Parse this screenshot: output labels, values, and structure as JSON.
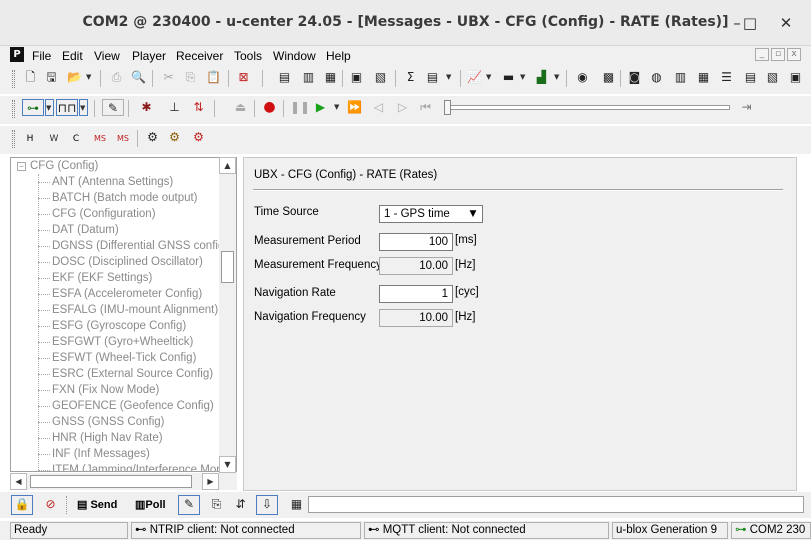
{
  "window": {
    "title": "COM2 @ 230400 - u-center 24.05 - [Messages - UBX - CFG (Config) - RATE (Rates)]"
  },
  "menu": [
    "File",
    "Edit",
    "View",
    "Player",
    "Receiver",
    "Tools",
    "Window",
    "Help"
  ],
  "tree": {
    "root": "CFG (Config)",
    "items": [
      "ANT (Antenna Settings)",
      "BATCH (Batch mode output)",
      "CFG (Configuration)",
      "DAT (Datum)",
      "DGNSS (Differential GNSS configur",
      "DOSC (Disciplined Oscillator)",
      "EKF (EKF Settings)",
      "ESFA (Accelerometer Config)",
      "ESFALG (IMU-mount Alignment)",
      "ESFG (Gyroscope Config)",
      "ESFGWT (Gyro+Wheeltick)",
      "ESFWT (Wheel-Tick Config)",
      "ESRC (External Source Config)",
      "FXN (Fix Now Mode)",
      "GEOFENCE (Geofence Config)",
      "GNSS (GNSS Config)",
      "HNR (High Nav Rate)",
      "INF (Inf Messages)",
      "ITFM (Jamming/Interference Moni"
    ]
  },
  "panel": {
    "header": "UBX - CFG (Config) - RATE (Rates)",
    "time_source": {
      "label": "Time Source",
      "value": "1 - GPS time"
    },
    "meas_period": {
      "label": "Measurement Period",
      "value": "100",
      "unit": "[ms]"
    },
    "meas_freq": {
      "label": "Measurement Frequency",
      "value": "10.00",
      "unit": "[Hz]"
    },
    "nav_rate": {
      "label": "Navigation Rate",
      "value": "1",
      "unit": "[cyc]"
    },
    "nav_freq": {
      "label": "Navigation Frequency",
      "value": "10.00",
      "unit": "[Hz]"
    }
  },
  "bottom": {
    "send": "Send",
    "poll": "Poll"
  },
  "status": {
    "ready": "Ready",
    "ntrip": "NTRIP client: Not connected",
    "mqtt": "MQTT client: Not connected",
    "generation": "u-blox Generation 9",
    "port": "COM2 230"
  },
  "toolbar3": {
    "h": "H",
    "w": "W",
    "c": "C",
    "ms": "MS",
    "ms2": "MS"
  }
}
